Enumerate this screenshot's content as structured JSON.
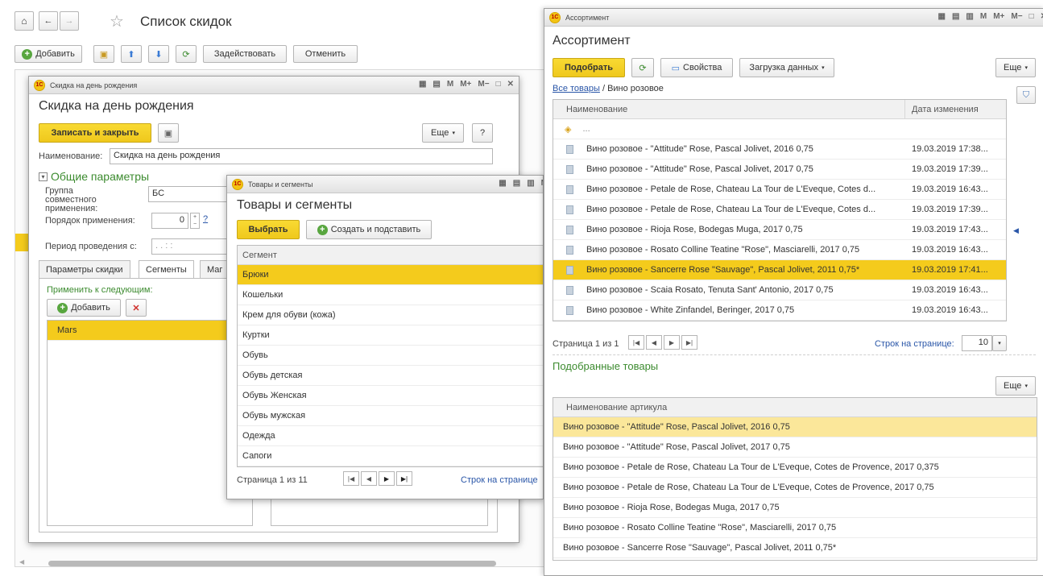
{
  "discount_list": {
    "title": "Список скидок",
    "toolbar": {
      "add": "Добавить",
      "activate": "Задействовать",
      "cancel": "Отменить"
    }
  },
  "birthday_form": {
    "window_title": "Скидка на день рождения",
    "title": "Скидка на день рождения",
    "save_close": "Записать и закрыть",
    "more": "Еще",
    "help": "?",
    "name_label": "Наименование:",
    "name_value": "Скидка на день рождения",
    "group_title": "Общие параметры",
    "compat_label": "Группа совместного применения:",
    "compat_value": "БС",
    "order_label": "Порядок применения:",
    "order_value": "0",
    "order_help": "?",
    "period_label": "Период проведения с:",
    "period_value": " .  .       :  :",
    "tabs": [
      "Параметры скидки",
      "Сегменты",
      "Маг"
    ],
    "apply_label": "Применить к следующим:",
    "add": "Добавить",
    "segments_rows": [
      "Mars"
    ]
  },
  "segments_window": {
    "window_title": "Товары и сегменты",
    "title": "Товары и сегменты",
    "select": "Выбрать",
    "create": "Создать и подставить",
    "column": "Сегмент",
    "rows": [
      "Брюки",
      "Кошельки",
      "Крем для обуви (кожа)",
      "Куртки",
      "Обувь",
      "Обувь детская",
      "Обувь Женская",
      "Обувь мужская",
      "Одежда",
      "Сапоги"
    ],
    "page_info": "Страница 1 из 11",
    "rows_per_page": "Строк на странице"
  },
  "assortment": {
    "window_title": "Ассортимент",
    "title": "Ассортимент",
    "pick": "Подобрать",
    "properties": "Свойства",
    "load": "Загрузка данных",
    "more": "Еще",
    "crumb_link": "Все товары",
    "crumb_current": " / Вино розовое",
    "col_name": "Наименование",
    "col_date": "Дата изменения",
    "up_row": "...",
    "rows": [
      {
        "name": "Вино розовое - \"Attitude\" Rose, Pascal Jolivet, 2016 0,75",
        "date": "19.03.2019 17:38..."
      },
      {
        "name": "Вино розовое - \"Attitude\" Rose, Pascal Jolivet, 2017 0,75",
        "date": "19.03.2019 17:39..."
      },
      {
        "name": "Вино розовое - Petale de Rose, Chateau La Tour de L'Eveque, Cotes d...",
        "date": "19.03.2019 16:43..."
      },
      {
        "name": "Вино розовое - Petale de Rose, Chateau La Tour de L'Eveque, Cotes d...",
        "date": "19.03.2019 17:39..."
      },
      {
        "name": "Вино розовое - Rioja Rose, Bodegas Muga, 2017 0,75",
        "date": "19.03.2019 17:43..."
      },
      {
        "name": "Вино розовое - Rosato Colline Teatine \"Rose\", Masciarelli, 2017 0,75",
        "date": "19.03.2019 16:43..."
      },
      {
        "name": "Вино розовое - Sancerre Rose \"Sauvage\", Pascal Jolivet, 2011 0,75*",
        "date": "19.03.2019 17:41..."
      },
      {
        "name": "Вино розовое - Scaia Rosato, Tenuta Sant' Antonio, 2017 0,75",
        "date": "19.03.2019 16:43..."
      },
      {
        "name": "Вино розовое - White Zinfandel, Beringer, 2017 0,75",
        "date": "19.03.2019 16:43..."
      }
    ],
    "page_info": "Страница 1 из 1",
    "rows_per_page_label": "Строк на странице:",
    "rows_per_page_value": "10",
    "selected_title": "Подобранные товары",
    "more2": "Еще",
    "col_article": "Наименование артикула",
    "selected_rows": [
      "Вино розовое - \"Attitude\" Rose, Pascal Jolivet, 2016 0,75",
      "Вино розовое - \"Attitude\" Rose, Pascal Jolivet, 2017 0,75",
      "Вино розовое - Petale de Rose, Chateau La Tour de L'Eveque, Cotes de Provence, 2017 0,375",
      "Вино розовое - Petale de Rose, Chateau La Tour de L'Eveque, Cotes de Provence, 2017 0,75",
      "Вино розовое - Rioja Rose, Bodegas Muga, 2017 0,75",
      "Вино розовое - Rosato Colline Teatine \"Rose\", Masciarelli, 2017 0,75",
      "Вино розовое - Sancerre Rose \"Sauvage\", Pascal Jolivet, 2011 0,75*"
    ]
  },
  "colors": {
    "accent_yellow": "#f4cb1c",
    "selected_row_light": "#fbe79a",
    "link_blue": "#2a56a8",
    "green_text": "#3c8b2f"
  },
  "icons": [
    "home-icon",
    "back-arrow-icon",
    "forward-arrow-icon",
    "star-icon",
    "refresh-icon",
    "calculator-icon",
    "calendar-icon",
    "close-icon",
    "filter-icon",
    "delete-icon"
  ]
}
